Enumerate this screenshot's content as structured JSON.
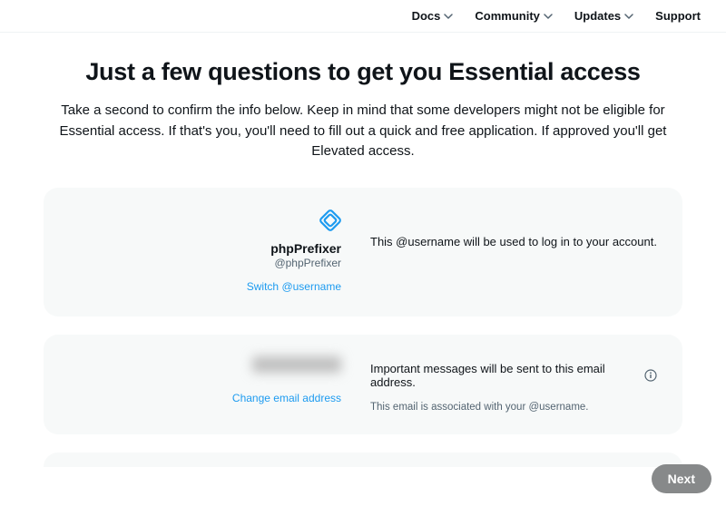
{
  "nav": {
    "docs": "Docs",
    "community": "Community",
    "updates": "Updates",
    "support": "Support"
  },
  "page": {
    "title": "Just a few questions to get you Essential access",
    "subtitle": "Take a second to confirm the info below. Keep in mind that some developers might not be eligible for Essential access. If that's you, you'll need to fill out a quick and free application. If approved you'll get Elevated access."
  },
  "username_card": {
    "display_name": "phpPrefixer",
    "handle": "@phpPrefixer",
    "switch_label": "Switch @username",
    "description": "This @username will be used to log in to your account."
  },
  "email_card": {
    "change_label": "Change email address",
    "description": "Important messages will be sent to this email address.",
    "subnote": "This email is associated with your @username."
  },
  "footer": {
    "next_label": "Next"
  },
  "colors": {
    "link": "#1d9bf0",
    "muted": "#536471",
    "card_bg": "#f7f9f9"
  }
}
